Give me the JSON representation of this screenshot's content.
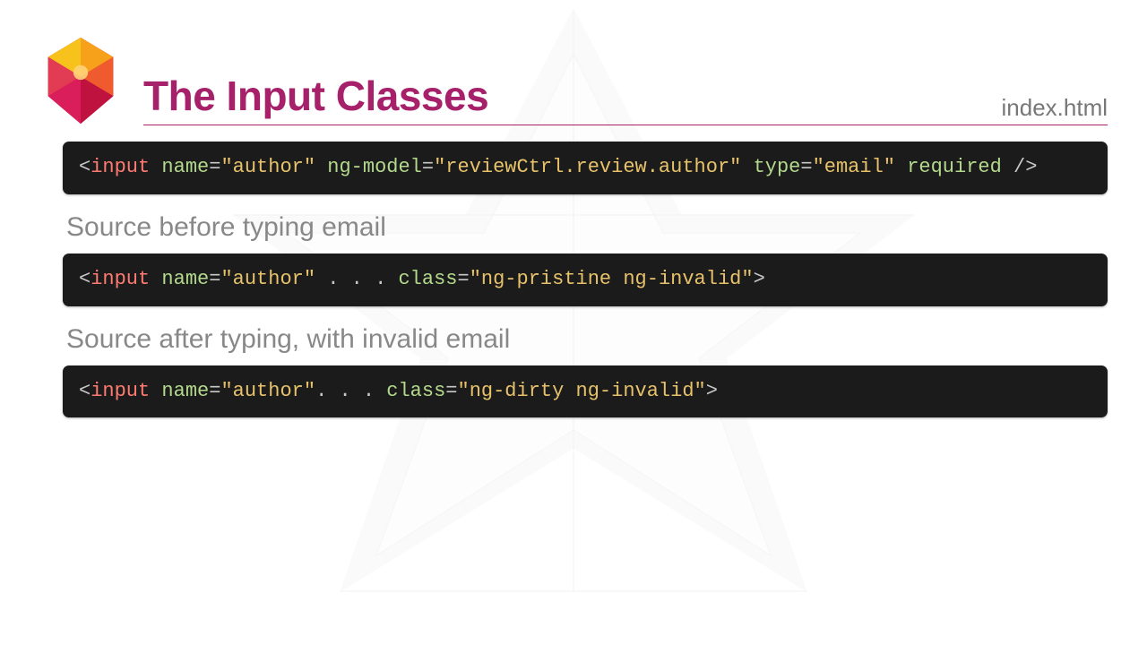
{
  "title": "The Input Classes",
  "filename": "index.html",
  "subheading1": "Source before typing email",
  "subheading2": "Source after typing, with invalid email",
  "code1": {
    "open": "<",
    "tag": "input",
    "a1": "name",
    "v1": "\"author\"",
    "a2": "ng-model",
    "v2": "\"reviewCtrl.review.author\"",
    "a3": "type",
    "v3": "\"email\"",
    "a4": "required",
    "close": "/>"
  },
  "code2": {
    "open": "<",
    "tag": "input",
    "a1": "name",
    "v1": "\"author\"",
    "dots": " . . . ",
    "a2": "class",
    "v2": "\"ng-pristine ng-invalid\"",
    "close": ">"
  },
  "code3": {
    "open": "<",
    "tag": "input",
    "a1": "name",
    "v1": "\"author\"",
    "dots": ". . . ",
    "a2": "class",
    "v2": "\"ng-dirty ng-invalid\"",
    "close": ">"
  }
}
